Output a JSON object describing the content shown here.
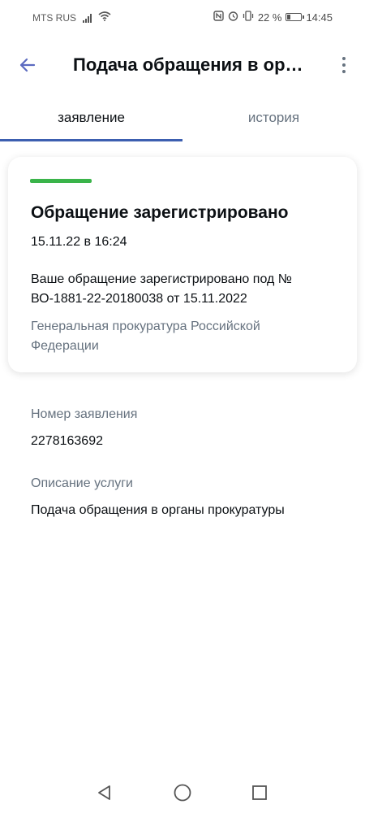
{
  "status_bar": {
    "carrier": "MTS RUS",
    "battery_text": "22 %",
    "battery_level": 0.22,
    "time": "14:45",
    "icons": [
      "signal-icon",
      "wifi-icon",
      "nfc-icon",
      "alarm-icon",
      "vibrate-icon",
      "battery-icon"
    ]
  },
  "header": {
    "title": "Подача обращения в органы прокуратуры",
    "back_icon": "arrow-left-icon",
    "menu_icon": "more-vertical-icon"
  },
  "tabs": [
    {
      "label": "заявление",
      "active": true
    },
    {
      "label": "история",
      "active": false
    }
  ],
  "status_card": {
    "accent_color": "#3ab44a",
    "title": "Обращение зарегистрировано",
    "date": "15.11.22 в 16:24",
    "message": "Ваше обращение зарегистрировано под № ВО-1881-22-20180038 от 15.11.2022",
    "organization": "Генеральная прокуратура Российской Федерации"
  },
  "details": {
    "application_number_label": "Номер заявления",
    "application_number": "2278163692",
    "service_description_label": "Описание услуги",
    "service_description": "Подача обращения в органы прокуратуры"
  },
  "colors": {
    "accent_blue": "#3c5fb0",
    "secondary_text": "#66727f",
    "primary_text": "#0c1014"
  }
}
